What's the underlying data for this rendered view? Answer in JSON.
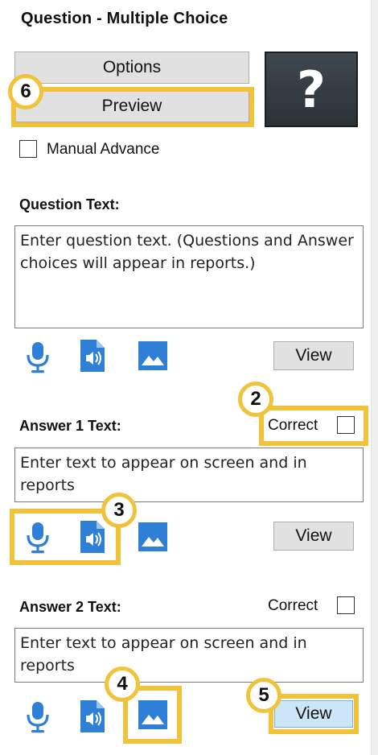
{
  "header": {
    "title": "Question - Multiple Choice"
  },
  "buttons": {
    "options": "Options",
    "preview": "Preview"
  },
  "preview_box": {
    "symbol": "?"
  },
  "manual_advance": {
    "label": "Manual Advance",
    "checked": false
  },
  "question": {
    "label": "Question Text:",
    "placeholder": "Enter question text. (Questions and Answer choices will appear in reports.)",
    "view_label": "View"
  },
  "answer1": {
    "label": "Answer 1 Text:",
    "correct_label": "Correct",
    "placeholder": "Enter text to appear on screen and in reports",
    "view_label": "View"
  },
  "answer2": {
    "label": "Answer 2 Text:",
    "correct_label": "Correct",
    "placeholder": "Enter text to appear on screen and in reports",
    "view_label": "View"
  },
  "icons": {
    "mic": "microphone-icon",
    "audio": "audio-file-icon",
    "image": "image-icon"
  },
  "callouts": {
    "c2": "2",
    "c3": "3",
    "c4": "4",
    "c5": "5",
    "c6": "6"
  },
  "colors": {
    "accent_icon": "#2f7fd6",
    "highlight": "#f0c33a",
    "view_selected": "#cde6f7"
  }
}
